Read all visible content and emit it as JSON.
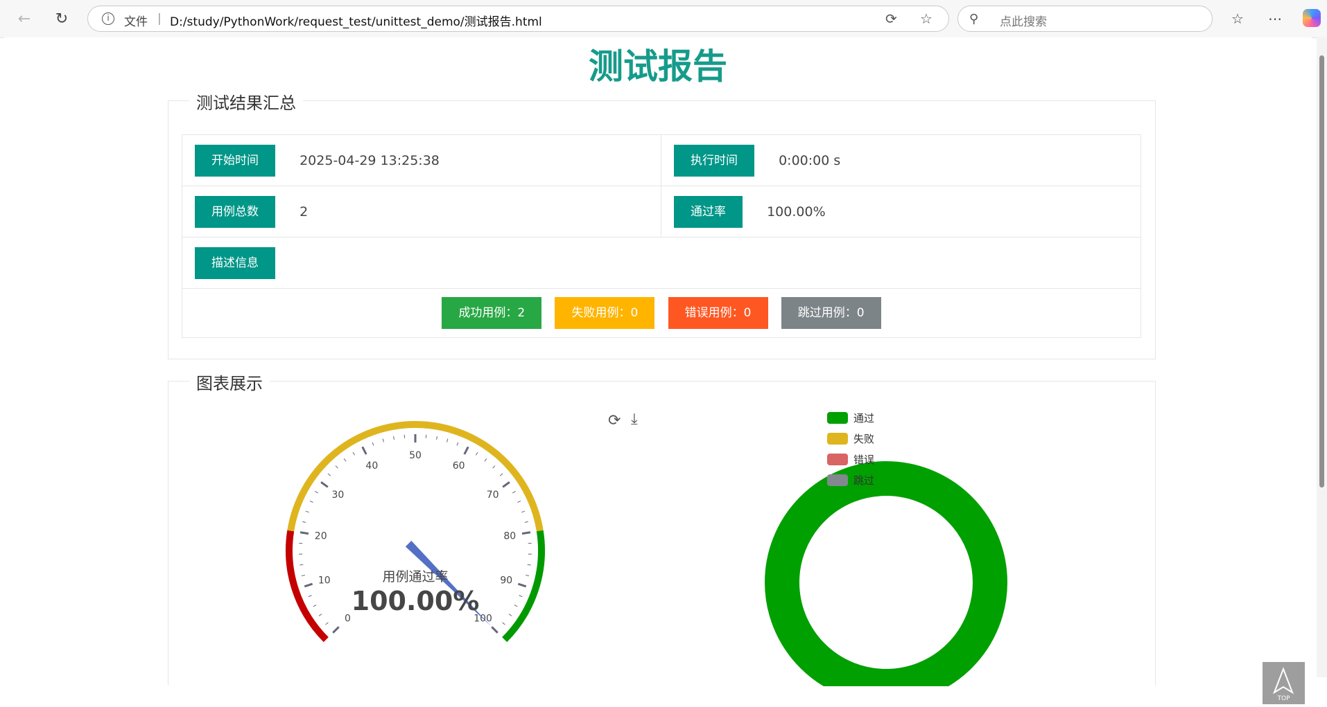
{
  "browser": {
    "address_file_label": "文件",
    "address_separator": "|",
    "url": "D:/study/PythonWork/request_test/unittest_demo/测试报告.html",
    "search_placeholder": "点此搜索"
  },
  "report": {
    "title": "测试报告",
    "summary_legend": "测试结果汇总",
    "start_time_label": "开始时间",
    "start_time_value": "2025-04-29 13:25:38",
    "exec_time_label": "执行时间",
    "exec_time_value": "0:00:00 s",
    "total_label": "用例总数",
    "total_value": "2",
    "pass_rate_label": "通过率",
    "pass_rate_value": "100.00%",
    "desc_label": "描述信息",
    "badges": [
      {
        "text": "成功用例：2",
        "color": "#28a745"
      },
      {
        "text": "失败用例：0",
        "color": "#ffb400"
      },
      {
        "text": "错误用例：0",
        "color": "#ff5722"
      },
      {
        "text": "跳过用例：0",
        "color": "#7d8487"
      }
    ],
    "chart_legend": "图表展示",
    "top_label": "TOP"
  },
  "chart_data": [
    {
      "type": "gauge",
      "title": "用例通过率",
      "value": 100.0,
      "value_label": "100.00%",
      "min": 0,
      "max": 100,
      "ticks": [
        "0",
        "10",
        "20",
        "30",
        "40",
        "50",
        "60",
        "70",
        "80",
        "90",
        "100"
      ],
      "bands": [
        {
          "to": 0.2,
          "color": "#c40000"
        },
        {
          "to": 0.8,
          "color": "#dfb51f"
        },
        {
          "to": 1.0,
          "color": "#009a00"
        }
      ],
      "pointer_color": "#5470c6"
    },
    {
      "type": "pie",
      "style": "donut",
      "legend": [
        "通过",
        "失败",
        "错误",
        "跳过"
      ],
      "values": [
        2,
        0,
        0,
        0
      ],
      "colors": [
        "#00a000",
        "#dfb51f",
        "#d96464",
        "#82888d"
      ],
      "legend_position": "top-left"
    }
  ]
}
